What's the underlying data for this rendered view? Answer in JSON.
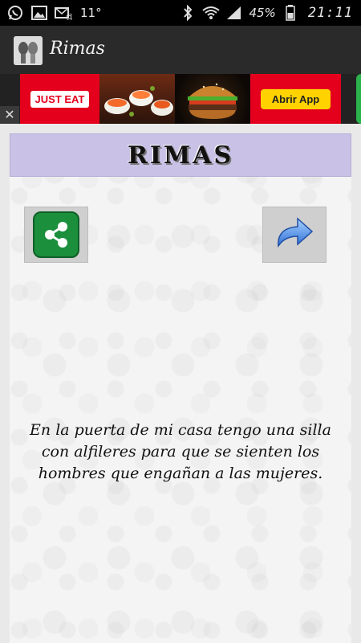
{
  "status_bar": {
    "temperature": "11°",
    "battery_percent": "45%",
    "time": "21:11",
    "icons": [
      "whatsapp-icon",
      "gallery-icon",
      "mail-notification-icon",
      "bluetooth-icon",
      "wifi-icon",
      "signal-icon",
      "battery-icon"
    ]
  },
  "action_bar": {
    "title": "Rimas",
    "icon": "app-icon"
  },
  "ad": {
    "brand": "JUST EAT",
    "cta": "Abrir App",
    "close": "✕",
    "colors": {
      "brand_red": "#e4001c",
      "cta_yellow": "#ffd200"
    }
  },
  "content": {
    "banner_title": "RIMAS",
    "share_button": "share-icon",
    "next_button": "redo-arrow-icon",
    "rhyme": "En la puerta de mi casa tengo una silla con alfileres para que se sienten los hombres que engañan a las mujeres."
  },
  "colors": {
    "banner_bg": "#c9c2e6",
    "share_green": "#1b8f3c",
    "actionbar_bg": "#2a2a2a"
  }
}
